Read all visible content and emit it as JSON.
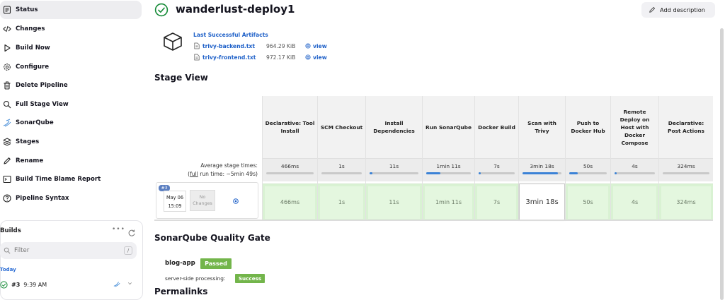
{
  "sidebar": {
    "items": [
      {
        "label": "Status",
        "icon": "status-doc-icon"
      },
      {
        "label": "Changes",
        "icon": "code-icon"
      },
      {
        "label": "Build Now",
        "icon": "play-icon"
      },
      {
        "label": "Configure",
        "icon": "gear-icon"
      },
      {
        "label": "Delete Pipeline",
        "icon": "trash-icon"
      },
      {
        "label": "Full Stage View",
        "icon": "search-icon"
      },
      {
        "label": "SonarQube",
        "icon": "sonarqube-icon"
      },
      {
        "label": "Stages",
        "icon": "layers-icon"
      },
      {
        "label": "Rename",
        "icon": "pencil-icon"
      },
      {
        "label": "Build Time Blame Report",
        "icon": "terminal-icon"
      },
      {
        "label": "Pipeline Syntax",
        "icon": "help-icon"
      }
    ],
    "builds": {
      "title": "Builds",
      "filter_placeholder": "Filter",
      "filter_shortcut": "/",
      "group_label": "Today",
      "entries": [
        {
          "number": "#3",
          "time": "9:39 AM"
        }
      ]
    }
  },
  "header": {
    "title": "wanderlust-deploy1",
    "add_description": "Add description"
  },
  "artifacts": {
    "title": "Last Successful Artifacts",
    "files": [
      {
        "name": "trivy-backend.txt",
        "size": "964.29 KiB",
        "view": "view"
      },
      {
        "name": "trivy-frontend.txt",
        "size": "972.17 KiB",
        "view": "view"
      }
    ]
  },
  "stage_view": {
    "title": "Stage View",
    "avg_label_line1": "Average stage times:",
    "avg_label_line2_prefix": "(",
    "avg_label_full": "full",
    "avg_label_line2_suffix": " run time: ~5min 49s)",
    "build": {
      "badge": "#3",
      "date": "May 06",
      "time": "15:09",
      "no_changes": "No Changes"
    },
    "stages": [
      {
        "name": "Declarative: Tool Install",
        "avg": "466ms",
        "run": "466ms",
        "avg_fraction": 0.0
      },
      {
        "name": "SCM Checkout",
        "avg": "1s",
        "run": "1s",
        "avg_fraction": 0.0
      },
      {
        "name": "Install Dependencies",
        "avg": "11s",
        "run": "11s",
        "avg_fraction": 0.03
      },
      {
        "name": "Run SonarQube",
        "avg": "1min 11s",
        "run": "1min 11s",
        "avg_fraction": 0.2
      },
      {
        "name": "Docker Build",
        "avg": "7s",
        "run": "7s",
        "avg_fraction": 0.02
      },
      {
        "name": "Scan with Trivy",
        "avg": "3min 18s",
        "run": "3min 18s",
        "avg_fraction": 0.57,
        "highlight": true
      },
      {
        "name": "Push to Docker Hub",
        "avg": "50s",
        "run": "50s",
        "avg_fraction": 0.14
      },
      {
        "name": "Remote Deploy on Host with Docker Compose",
        "avg": "4s",
        "run": "4s",
        "avg_fraction": 0.01
      },
      {
        "name": "Declarative: Post Actions",
        "avg": "324ms",
        "run": "324ms",
        "avg_fraction": 0.0
      }
    ]
  },
  "quality_gate": {
    "title": "SonarQube Quality Gate",
    "project": "blog-app",
    "status": "Passed",
    "server_label": "server-side processing:",
    "server_status": "Success"
  },
  "permalinks": {
    "title": "Permalinks"
  },
  "colors": {
    "accent": "#1e60c8",
    "success": "#73b54b",
    "stage_green": "#d9f2d3",
    "check_green": "#138a36"
  }
}
